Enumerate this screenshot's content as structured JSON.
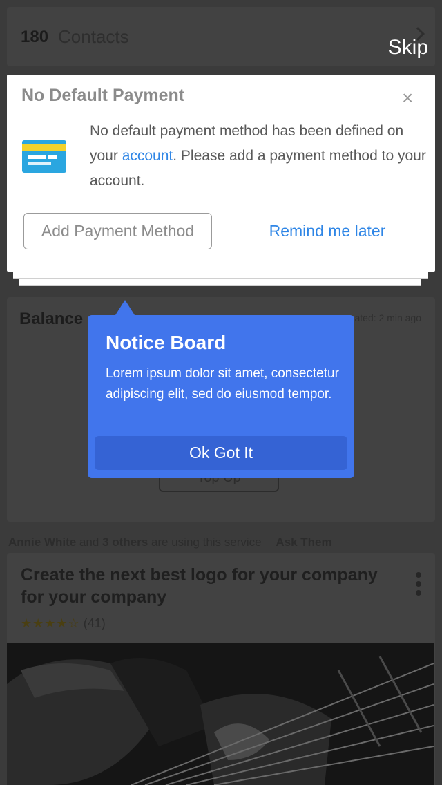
{
  "contacts": {
    "count": "180",
    "label": "Contacts"
  },
  "skip_label": "Skip",
  "payment_dialog": {
    "title": "No Default Payment",
    "close_glyph": "×",
    "message_prefix": "No default payment method has been defined on your ",
    "message_link": "account",
    "message_suffix": ". Please add a payment method to your account.",
    "add_button": "Add Payment Method",
    "remind_button": "Remind me later"
  },
  "balance": {
    "title": "Balance",
    "updated": "ated: 2 min ago",
    "topup_label": "Top Up"
  },
  "notice": {
    "title": "Notice Board",
    "body": "Lorem ipsum dolor sit amet, consectetur adipiscing elit, sed do eiusmod tempor.",
    "button": "Ok Got It"
  },
  "social": {
    "name": "Annie White",
    "and": "and",
    "others": "3 others",
    "suffix": "are using this service",
    "ask": "Ask Them"
  },
  "service": {
    "title": "Create the next best logo for your company for your company",
    "stars": "★★★★☆",
    "rating_count": "(41)",
    "rating_value": 4
  }
}
